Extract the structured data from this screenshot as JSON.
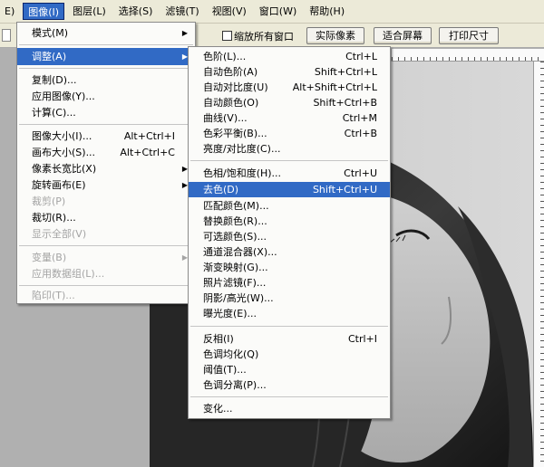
{
  "menubar": {
    "items": [
      {
        "label": "E)"
      },
      {
        "label": "图像(I)"
      },
      {
        "label": "图层(L)"
      },
      {
        "label": "选择(S)"
      },
      {
        "label": "滤镜(T)"
      },
      {
        "label": "视图(V)"
      },
      {
        "label": "窗口(W)"
      },
      {
        "label": "帮助(H)"
      }
    ]
  },
  "options_bar": {
    "zoom_all_windows_label": "缩放所有窗口",
    "actual_pixels_label": "实际像素",
    "fit_screen_label": "适合屏幕",
    "print_size_label": "打印尺寸"
  },
  "image_menu": {
    "items": [
      {
        "label": "模式(M)",
        "shortcut": "",
        "submenu": true,
        "disabled": false
      },
      {
        "label": "调整(A)",
        "shortcut": "",
        "submenu": true,
        "disabled": false
      },
      {
        "label": "复制(D)...",
        "shortcut": "",
        "submenu": false,
        "disabled": false
      },
      {
        "label": "应用图像(Y)...",
        "shortcut": "",
        "submenu": false,
        "disabled": false
      },
      {
        "label": "计算(C)...",
        "shortcut": "",
        "submenu": false,
        "disabled": false
      },
      {
        "label": "图像大小(I)...",
        "shortcut": "Alt+Ctrl+I",
        "submenu": false,
        "disabled": false
      },
      {
        "label": "画布大小(S)...",
        "shortcut": "Alt+Ctrl+C",
        "submenu": false,
        "disabled": false
      },
      {
        "label": "像素长宽比(X)",
        "shortcut": "",
        "submenu": true,
        "disabled": false
      },
      {
        "label": "旋转画布(E)",
        "shortcut": "",
        "submenu": true,
        "disabled": false
      },
      {
        "label": "裁剪(P)",
        "shortcut": "",
        "submenu": false,
        "disabled": true
      },
      {
        "label": "裁切(R)...",
        "shortcut": "",
        "submenu": false,
        "disabled": false
      },
      {
        "label": "显示全部(V)",
        "shortcut": "",
        "submenu": false,
        "disabled": true
      },
      {
        "label": "变量(B)",
        "shortcut": "",
        "submenu": true,
        "disabled": true
      },
      {
        "label": "应用数据组(L)...",
        "shortcut": "",
        "submenu": false,
        "disabled": true
      },
      {
        "label": "陷印(T)...",
        "shortcut": "",
        "submenu": false,
        "disabled": true
      }
    ]
  },
  "adjust_menu": {
    "items": [
      {
        "label": "色阶(L)...",
        "shortcut": "Ctrl+L"
      },
      {
        "label": "自动色阶(A)",
        "shortcut": "Shift+Ctrl+L"
      },
      {
        "label": "自动对比度(U)",
        "shortcut": "Alt+Shift+Ctrl+L"
      },
      {
        "label": "自动颜色(O)",
        "shortcut": "Shift+Ctrl+B"
      },
      {
        "label": "曲线(V)...",
        "shortcut": "Ctrl+M"
      },
      {
        "label": "色彩平衡(B)...",
        "shortcut": "Ctrl+B"
      },
      {
        "label": "亮度/对比度(C)...",
        "shortcut": ""
      },
      {
        "label": "色相/饱和度(H)...",
        "shortcut": "Ctrl+U"
      },
      {
        "label": "去色(D)",
        "shortcut": "Shift+Ctrl+U"
      },
      {
        "label": "匹配颜色(M)...",
        "shortcut": ""
      },
      {
        "label": "替换颜色(R)...",
        "shortcut": ""
      },
      {
        "label": "可选颜色(S)...",
        "shortcut": ""
      },
      {
        "label": "通道混合器(X)...",
        "shortcut": ""
      },
      {
        "label": "渐变映射(G)...",
        "shortcut": ""
      },
      {
        "label": "照片滤镜(F)...",
        "shortcut": ""
      },
      {
        "label": "阴影/高光(W)...",
        "shortcut": ""
      },
      {
        "label": "曝光度(E)...",
        "shortcut": ""
      },
      {
        "label": "反相(I)",
        "shortcut": "Ctrl+I"
      },
      {
        "label": "色调均化(Q)",
        "shortcut": ""
      },
      {
        "label": "阈值(T)...",
        "shortcut": ""
      },
      {
        "label": "色调分离(P)...",
        "shortcut": ""
      },
      {
        "label": "变化...",
        "shortcut": ""
      }
    ]
  },
  "colors": {
    "highlight": "#316ac5",
    "menu_bg": "#fbfbf9",
    "disabled_text": "#a4a4a4",
    "toolbar_bg": "#ecead8"
  }
}
